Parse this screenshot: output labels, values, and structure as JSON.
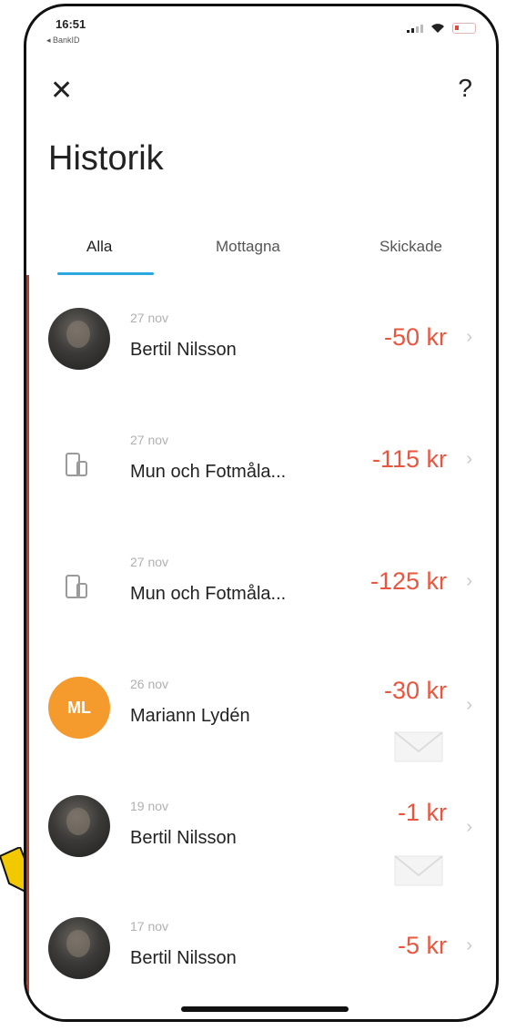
{
  "status_bar": {
    "time": "16:51",
    "back_app": "◂ BankID"
  },
  "header": {
    "close_icon": "✕",
    "help_icon": "?",
    "title": "Historik"
  },
  "tabs": [
    {
      "label": "Alla",
      "active": true
    },
    {
      "label": "Mottagna",
      "active": false
    },
    {
      "label": "Skickade",
      "active": false
    }
  ],
  "transactions": [
    {
      "date": "27 nov",
      "name": "Bertil Nilsson",
      "amount": "-50 kr",
      "avatar": "photo"
    },
    {
      "date": "27 nov",
      "name": "Mun och Fotmåla...",
      "amount": "-115 kr",
      "avatar": "phone-icon"
    },
    {
      "date": "27 nov",
      "name": "Mun och Fotmåla...",
      "amount": "-125 kr",
      "avatar": "phone-icon"
    },
    {
      "date": "26 nov",
      "name": "Mariann Lydén",
      "amount": "-30 kr",
      "avatar": "initials",
      "initials": "ML",
      "has_message": true
    },
    {
      "date": "19 nov",
      "name": "Bertil Nilsson",
      "amount": "-1 kr",
      "avatar": "photo",
      "has_message": true
    },
    {
      "date": "17 nov",
      "name": "Bertil Nilsson",
      "amount": "-5 kr",
      "avatar": "photo"
    }
  ],
  "colors": {
    "amount": "#e8563f",
    "tab_underline": "#2aa8df",
    "initials_avatar": "#f59a2c"
  },
  "chevron": "›"
}
